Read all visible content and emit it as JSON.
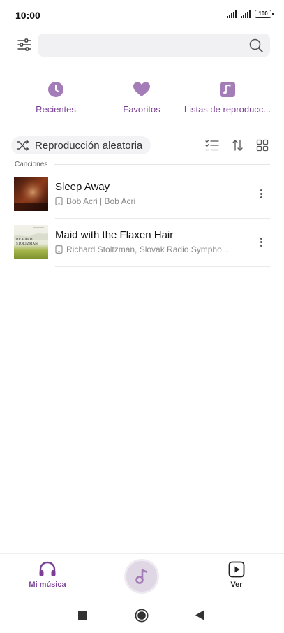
{
  "status_bar": {
    "time": "10:00",
    "battery": "100"
  },
  "search": {
    "placeholder": "",
    "value": "",
    "icons": {
      "filter": "sliders-icon",
      "search": "search-icon"
    }
  },
  "quick_nav": [
    {
      "label": "Recientes",
      "icon": "clock-icon"
    },
    {
      "label": "Favoritos",
      "icon": "heart-icon"
    },
    {
      "label": "Listas de reproducc...",
      "icon": "music-note-icon"
    }
  ],
  "toolbar": {
    "shuffle_label": "Reproducción aleatoria",
    "icons": [
      "shuffle-icon",
      "multi-select-icon",
      "sort-icon",
      "grid-view-icon"
    ]
  },
  "section": {
    "label": "Canciones"
  },
  "songs": [
    {
      "title": "Sleep Away",
      "artist": "Bob Acri | Bob Acri"
    },
    {
      "title": "Maid with the Flaxen Hair",
      "artist": "Richard Stoltzman, Slovak Radio Sympho..."
    }
  ],
  "album_art_text": {
    "song2_line1": "RICHARD",
    "song2_line2": "STOLTZMAN"
  },
  "bottom_nav": {
    "left_label": "Mi música",
    "right_label": "Ver"
  },
  "colors": {
    "accent": "#7a3f95",
    "accent_icon": "#a47cb8",
    "search_bg": "#f1f1f3",
    "chip_bg": "#f3f2f5",
    "disc_bg": "#e0d7e4"
  }
}
